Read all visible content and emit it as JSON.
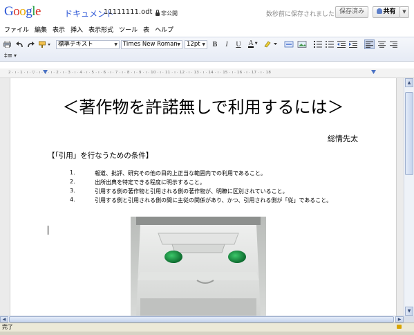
{
  "header": {
    "logo": "Google",
    "product": "ドキュメント",
    "doc_name": "11111111.odt",
    "visibility": "非公開",
    "save_status": "数秒前に保存されました",
    "saved_button": "保存済み",
    "share_button": "共有"
  },
  "menu": [
    "ファイル",
    "編集",
    "表示",
    "挿入",
    "表示形式",
    "ツール",
    "表",
    "ヘルプ"
  ],
  "toolbar": {
    "style_select": "標準テキスト",
    "font_select": "Times New Roman",
    "size_select": "12pt",
    "bold": "B",
    "italic": "I",
    "underline": "U",
    "text_color": "A",
    "line_spacing": "‡≡"
  },
  "ruler": {
    "scale": "2 · ı · 1 · ı · ▽ · ı · 1 · ı · 2 · ı · 3 · ı · 4 · ı · 5 · ı · 6 · ı · 7 · ı · 8 · ı · 9 · ı · 10 · ı · 11 · ı · 12 · ı · 13 · ı · 14 · ı · 15 · ı · 16 · ı · 17 · ı · 18"
  },
  "document": {
    "title": "＜著作物を許諾無しで利用するには＞",
    "author": "総情先太",
    "section_heading": "【「引用」を行なうための条件】",
    "conditions": [
      {
        "num": "1.",
        "text": "報道、批評、研究その他の目的上正当な範囲内での利用であること。"
      },
      {
        "num": "2.",
        "text": "出所出典を特定できる程度に明示すること。"
      },
      {
        "num": "3.",
        "text": "引用する側の著作物と引用される側の著作物が、明瞭に区別されていること。"
      },
      {
        "num": "4.",
        "text": "引用する側と引用される側の間に主従の関係があり、かつ、引用される側が「従」であること。"
      }
    ]
  },
  "status": {
    "text": "完了"
  }
}
